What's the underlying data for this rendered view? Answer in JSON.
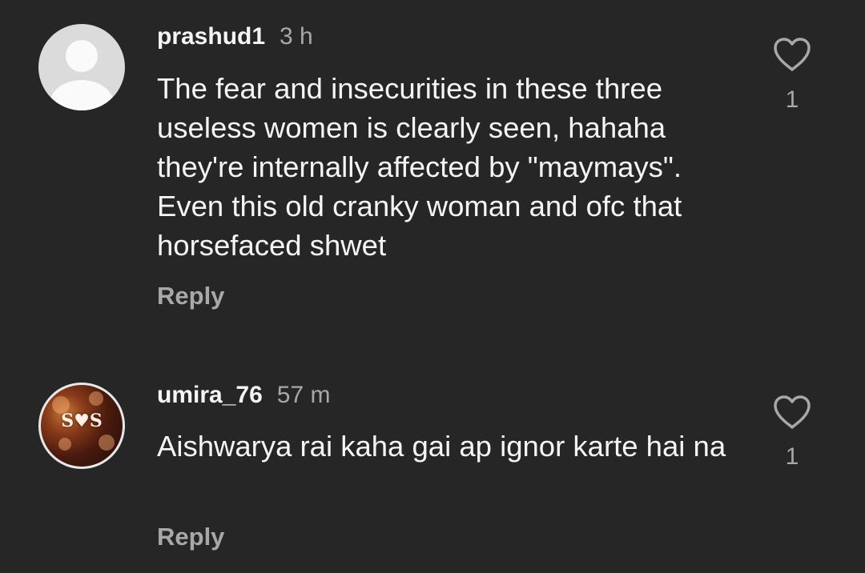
{
  "comments": [
    {
      "username": "prashud1",
      "time": "3 h",
      "text": "The fear and insecurities in these three useless women is clearly seen, hahaha they're internally affected by \"maymays\". Even this old cranky woman and ofc that horsefaced shwet",
      "reply_label": "Reply",
      "like_count": "1",
      "avatar": "default-avatar"
    },
    {
      "username": "umira_76",
      "time": "57 m",
      "text": "Aishwarya rai kaha gai ap ignor karte hai na",
      "reply_label": "Reply",
      "like_count": "1",
      "avatar": "photo-avatar",
      "avatar_text": "S♥S"
    }
  ]
}
